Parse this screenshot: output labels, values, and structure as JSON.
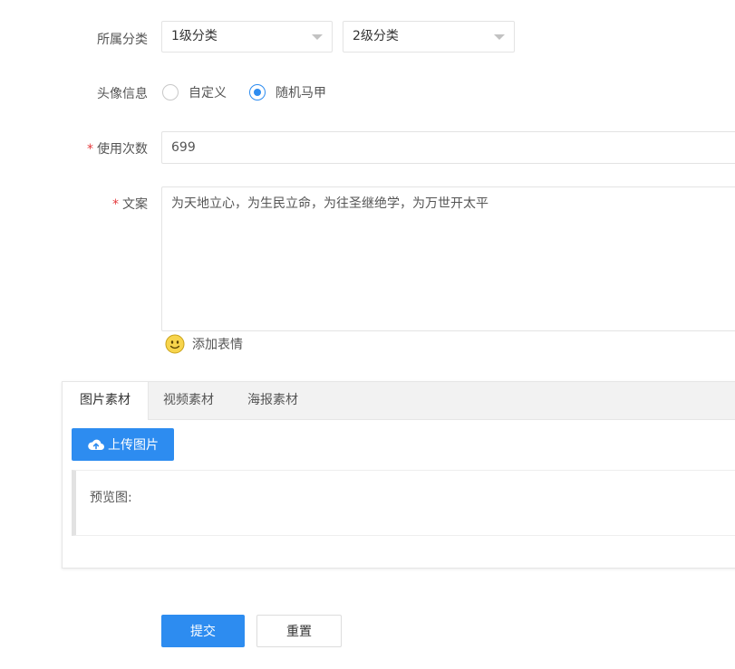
{
  "form": {
    "category": {
      "label": "所属分类",
      "level1_value": "1级分类",
      "level2_value": "2级分类"
    },
    "avatar": {
      "label": "头像信息",
      "options": [
        "自定义",
        "随机马甲"
      ],
      "selected": "随机马甲"
    },
    "usage_count": {
      "required_mark": "*",
      "label": "使用次数",
      "value": "699"
    },
    "copy_text": {
      "required_mark": "*",
      "label": "文案",
      "value": "为天地立心，为生民立命，为往圣继绝学，为万世开太平"
    },
    "emoji_link": "添加表情"
  },
  "media": {
    "tabs": [
      {
        "label": "图片素材",
        "active": true
      },
      {
        "label": "视频素材",
        "active": false
      },
      {
        "label": "海报素材",
        "active": false
      }
    ],
    "upload_label": "上传图片",
    "preview_label": "预览图:"
  },
  "actions": {
    "submit_label": "提交",
    "reset_label": "重置"
  },
  "colors": {
    "primary": "#2d8cf0",
    "required": "#e4393c"
  }
}
